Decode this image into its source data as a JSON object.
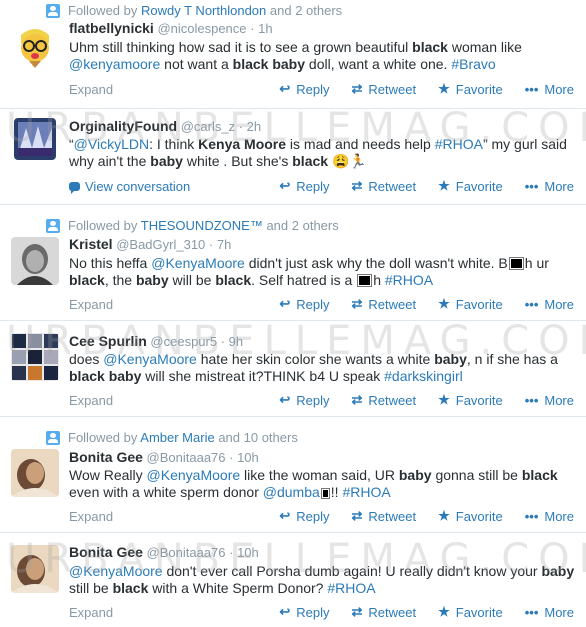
{
  "watermark": "URBANBELLEMAG.COM",
  "actions": {
    "reply": "Reply",
    "retweet": "Retweet",
    "favorite": "Favorite",
    "more": "More"
  },
  "tweets": [
    {
      "context": {
        "prefix": "Followed by",
        "name": "Rowdy T Northlondon",
        "suffix": "and 2 others"
      },
      "name": "flatbellynicki",
      "handle": "@nicolespence",
      "time": "· 1h",
      "text": [
        "Uhm still thinking how sad it is to see a grown beautiful ",
        "black",
        " woman like ",
        "@kenyamoore",
        " not want a ",
        "black baby",
        " doll, want a white one. ",
        "#Bravo"
      ],
      "footer": "Expand"
    },
    {
      "name": "OrginalityFound",
      "handle": "@carls_z",
      "time": "· 2h",
      "text": [
        "“",
        "@VickyLDN",
        ": I think ",
        "Kenya Moore",
        " is mad and needs help ",
        "#RHOA",
        "” my gurl said why ain't the ",
        "baby",
        " white . But she's ",
        "black"
      ],
      "footer": "View conversation"
    },
    {
      "context": {
        "prefix": "Followed by",
        "name": "THESOUNDZONE™",
        "suffix": "and 2 others"
      },
      "name": "Kristel",
      "handle": "@BadGyrl_310",
      "time": "· 7h",
      "text": [
        "No this heffa ",
        "@KenyaMoore",
        " didn't just ask why the doll wasn't white. B",
        "h ur ",
        "black",
        ", the ",
        "baby",
        " will be ",
        "black",
        ". Self hatred is a ",
        "h ",
        "#RHOA"
      ],
      "footer": "Expand"
    },
    {
      "name": "Cee Spurlin",
      "handle": "@ceespur5",
      "time": "· 9h",
      "text": [
        "does ",
        "@KenyaMoore",
        " hate her skin color she wants a white ",
        "baby",
        ", n if she has a ",
        "black baby",
        " will she mistreat it?THINK b4 U speak ",
        "#darkskingirl"
      ],
      "footer": "Expand"
    },
    {
      "context": {
        "prefix": "Followed by",
        "name": "Amber Marie",
        "suffix": "and 10 others"
      },
      "name": "Bonita Gee",
      "handle": "@Bonitaaa76",
      "time": "· 10h",
      "text": [
        "Wow Really ",
        "@KenyaMoore",
        "  like the woman said, UR ",
        "baby",
        " gonna still be ",
        "black",
        " even with a white sperm donor ",
        "@dumba",
        "!! ",
        "#RHOA"
      ],
      "footer": "Expand"
    },
    {
      "name": "Bonita Gee",
      "handle": "@Bonitaaa76",
      "time": "· 10h",
      "text": [
        "@KenyaMoore",
        " don't ever call Porsha dumb again! U really didn't know your ",
        "baby",
        " still be ",
        "black",
        " with a White Sperm Donor?  ",
        "#RHOA"
      ],
      "footer": "Expand"
    }
  ]
}
